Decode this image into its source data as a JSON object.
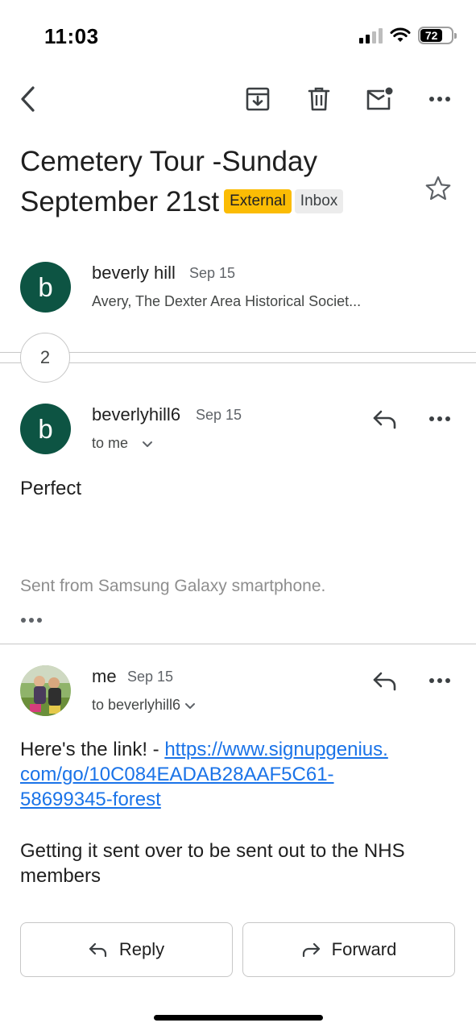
{
  "status_bar": {
    "time": "11:03",
    "battery": "72"
  },
  "toolbar": {
    "back_icon": "back-chevron-icon",
    "archive_icon": "archive-icon",
    "delete_icon": "trash-icon",
    "mark_unread_icon": "mark-unread-icon",
    "more_icon": "more-horizontal-icon"
  },
  "subject": {
    "text": "Cemetery Tour -Sunday September 21st",
    "labels": [
      "External",
      "Inbox"
    ],
    "star_icon": "star-outline-icon"
  },
  "collapsed_message": {
    "avatar_letter": "b",
    "sender": "beverly hill",
    "date": "Sep 15",
    "snippet": "Avery, The Dexter Area Historical Societ..."
  },
  "collapsed_count": "2",
  "message1": {
    "avatar_letter": "b",
    "sender": "beverlyhill6",
    "date": "Sep 15",
    "recipient_line": "to me",
    "body": "Perfect",
    "signature": "Sent from Samsung Galaxy smartphone."
  },
  "message2": {
    "sender": "me",
    "date": "Sep 15",
    "recipient_line": "to beverlyhill6",
    "body_prefix": "Here's the link! - ",
    "link_line1": "https://www.signupgenius.",
    "link_line2": "com/go/10C084EADAB28AAF5C61-",
    "link_line3": "58699345-forest",
    "body_line2": "Getting it sent over to be sent out to the NHS members"
  },
  "actions": {
    "reply_label": "Reply",
    "forward_label": "Forward"
  },
  "colors": {
    "avatar_green": "#0d5443",
    "external_badge": "#fbbc04",
    "link_blue": "#1a73e8"
  }
}
